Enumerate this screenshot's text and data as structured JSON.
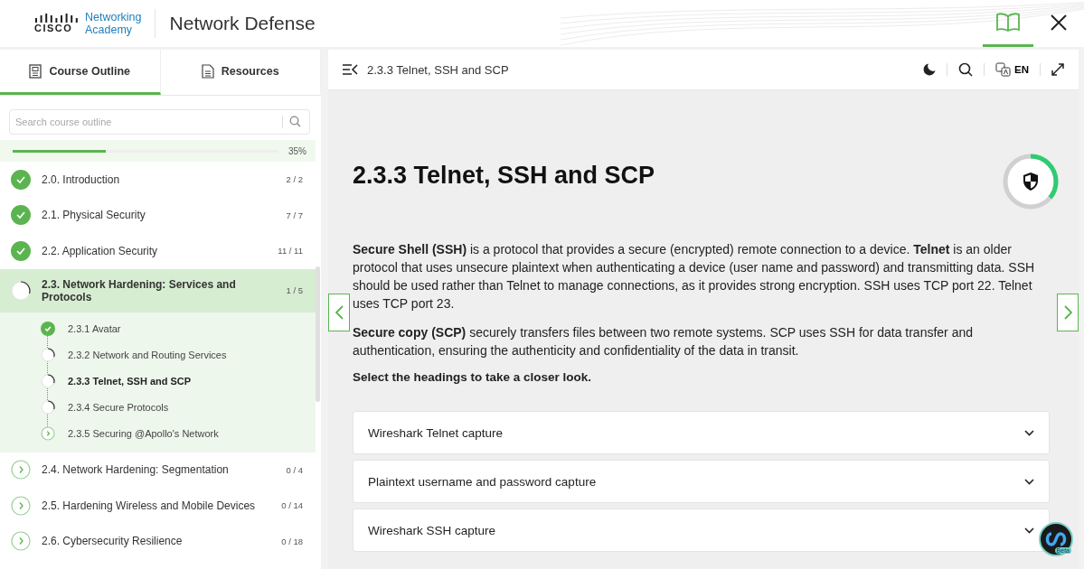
{
  "header": {
    "brand_top": "Networking",
    "brand_bottom": "Academy",
    "brand_wordmark": "CISCO",
    "title": "Network Defense",
    "book_selected": true
  },
  "sidebar": {
    "tabs": [
      {
        "label": "Course Outline",
        "selected": true
      },
      {
        "label": "Resources",
        "selected": false
      }
    ],
    "search": {
      "placeholder": "Search course outline"
    },
    "progress": {
      "level": 0.35,
      "reading": "35%"
    },
    "items": [
      {
        "label": "2.0. Introduction",
        "count": "2 / 2",
        "kind": "complete",
        "selected": false
      },
      {
        "label": "2.1. Physical Security",
        "count": "7 / 7",
        "kind": "complete",
        "selected": false
      },
      {
        "label": "2.2. Application Security",
        "count": "11 / 11",
        "kind": "complete",
        "selected": false
      },
      {
        "label": "2.3. Network Hardening: Services and Protocols",
        "count": "1 / 5",
        "kind": "in_progress",
        "selected": true,
        "children": [
          {
            "label": "2.3.1 Avatar",
            "kind": "complete",
            "selected": false
          },
          {
            "label": "2.3.2 Network and Routing Services",
            "kind": "in_progress",
            "selected": false
          },
          {
            "label": "2.3.3 Telnet, SSH and SCP",
            "kind": "in_progress",
            "selected": true
          },
          {
            "label": "2.3.4 Secure Protocols",
            "kind": "in_progress",
            "selected": false
          },
          {
            "label": "2.3.5 Securing @Apollo's Network",
            "kind": "not_started",
            "selected": false
          }
        ]
      },
      {
        "label": "2.4. Network Hardening: Segmentation",
        "count": "0 / 4",
        "kind": "not_started",
        "selected": false
      },
      {
        "label": "2.5. Hardening Wireless and Mobile Devices",
        "count": "0 / 14",
        "kind": "not_started",
        "selected": false
      },
      {
        "label": "2.6. Cybersecurity Resilience",
        "count": "0 / 18",
        "kind": "not_started",
        "selected": false
      }
    ]
  },
  "content": {
    "breadcrumb": "2.3.3 Telnet, SSH and SCP",
    "language": "EN",
    "title": "2.3.3 Telnet, SSH and SCP",
    "page_progress": {
      "level": 0.36
    },
    "paragraphs": [
      "**Secure Shell (SSH)** is a protocol that provides a secure (encrypted) remote connection to a device. **Telnet** is an older protocol that uses unsecure plaintext when authenticating a device (user name and password) and transmitting data. SSH should be used rather than Telnet to manage connections, as it provides strong encryption. SSH uses TCP port 22. Telnet uses TCP port 23.",
      "**Secure copy (SCP)** securely transfers files between two remote systems. SCP uses SSH for data transfer and authentication, ensuring the authenticity and confidentiality of the data in transit."
    ],
    "instruction": "Select the headings to take a closer look.",
    "accordions": [
      {
        "label": "Wireshark Telnet capture",
        "expanded": false
      },
      {
        "label": "Plaintext username and password capture",
        "expanded": false
      },
      {
        "label": "Wireshark SSH capture",
        "expanded": false
      }
    ],
    "assistant_badge": "Beta"
  }
}
